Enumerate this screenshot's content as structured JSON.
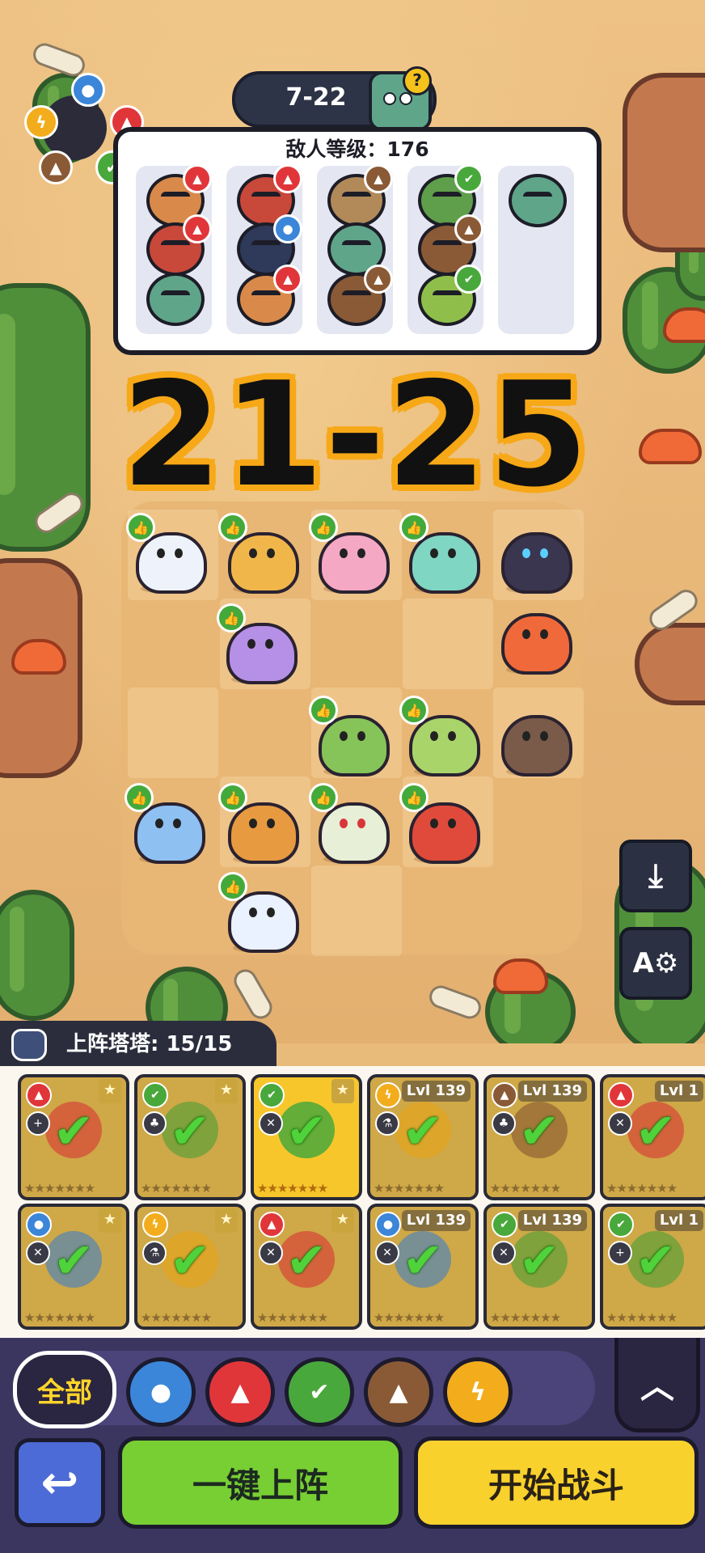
{
  "stage": {
    "level": "7-22"
  },
  "enemy_panel": {
    "level_label": "敌人等级：176",
    "columns": [
      {
        "elements": [
          "fire",
          "fire",
          ""
        ]
      },
      {
        "elements": [
          "fire",
          "water",
          "fire"
        ]
      },
      {
        "elements": [
          "earth",
          "",
          "earth"
        ]
      },
      {
        "elements": [
          "grass",
          "earth",
          "grass"
        ]
      },
      {
        "elements": [
          ""
        ]
      }
    ]
  },
  "overlay": {
    "range_text": "21-25"
  },
  "deck": {
    "header": "上阵塔塔: 15/15",
    "cards": [
      {
        "element": "fire",
        "role": "+",
        "level": "",
        "starred": true,
        "active": false
      },
      {
        "element": "grass",
        "role": "♣",
        "level": "",
        "starred": true,
        "active": false
      },
      {
        "element": "grass",
        "role": "✕",
        "level": "",
        "starred": true,
        "active": true
      },
      {
        "element": "thunder",
        "role": "⚗",
        "level": "Lvl 139",
        "starred": false,
        "active": false
      },
      {
        "element": "earth",
        "role": "♣",
        "level": "Lvl 139",
        "starred": false,
        "active": false
      },
      {
        "element": "fire",
        "role": "✕",
        "level": "Lvl 1",
        "starred": false,
        "active": false
      },
      {
        "element": "water",
        "role": "✕",
        "level": "",
        "starred": true,
        "active": false
      },
      {
        "element": "thunder",
        "role": "⚗",
        "level": "",
        "starred": true,
        "active": false
      },
      {
        "element": "fire",
        "role": "✕",
        "level": "",
        "starred": true,
        "active": false
      },
      {
        "element": "water",
        "role": "✕",
        "level": "Lvl 139",
        "starred": false,
        "active": false
      },
      {
        "element": "grass",
        "role": "✕",
        "level": "Lvl 139",
        "starred": false,
        "active": false
      },
      {
        "element": "grass",
        "role": "+",
        "level": "Lvl 1",
        "starred": false,
        "active": false
      }
    ]
  },
  "filters": {
    "all_label": "全部",
    "icons": [
      "water-drop-icon",
      "fire-icon",
      "leaf-icon",
      "mountain-icon",
      "lightning-icon"
    ]
  },
  "buttons": {
    "deploy_label": "一键上阵",
    "start_label": "开始战斗"
  },
  "colors": {
    "water": "#3b86d9",
    "fire": "#e0363a",
    "grass": "#49a83b",
    "earth": "#8a5a36",
    "thunder": "#f3ad1c",
    "deploy_button": "#78cf33",
    "start_button": "#f9d12d",
    "range_outline": "#f7a817"
  }
}
